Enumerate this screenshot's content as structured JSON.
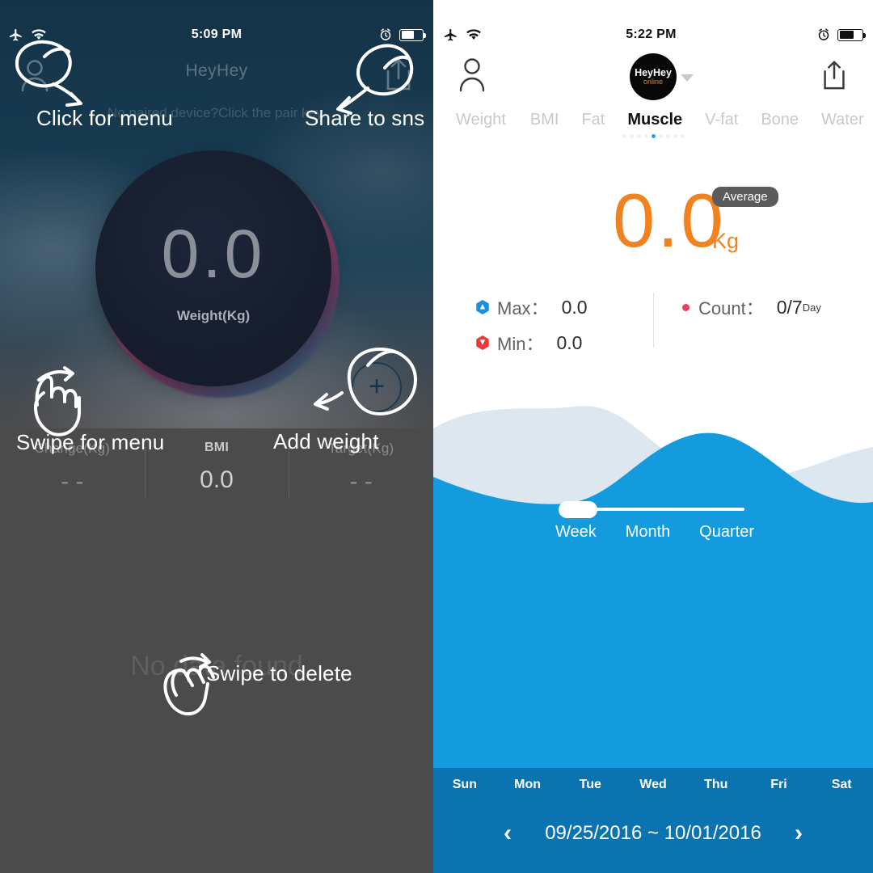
{
  "left_phone": {
    "status_bar": {
      "time": "5:09 PM",
      "airplane_icon": "airplane-icon",
      "wifi_icon": "wifi-icon",
      "alarm_icon": "alarm-clock-icon",
      "battery_icon": "battery-icon"
    },
    "nav": {
      "title": "HeyHey",
      "left_icon": "person-icon",
      "right_icon": "share-icon"
    },
    "pair_hint": "No paired device?Click the pair key.",
    "scale": {
      "value": "0.0",
      "unit_label": "Weight(Kg)"
    },
    "add_button": {
      "icon": "plus-icon"
    },
    "stats": [
      {
        "label": "Change(Kg)",
        "value": "- -"
      },
      {
        "label": "BMI",
        "value": "0.0"
      },
      {
        "label": "Target(Kg)",
        "value": "- -"
      }
    ],
    "empty_state": "No data found",
    "annotations": [
      {
        "text": "Click for menu"
      },
      {
        "text": "Share to sns"
      },
      {
        "text": "Swipe for menu"
      },
      {
        "text": "Add weight"
      },
      {
        "text": "Swipe to delete"
      }
    ]
  },
  "right_phone": {
    "status_bar": {
      "time": "5:22 PM",
      "airplane_icon": "airplane-icon",
      "wifi_icon": "wifi-icon",
      "alarm_icon": "alarm-clock-icon",
      "battery_icon": "battery-icon"
    },
    "nav": {
      "left_icon": "person-icon",
      "right_icon": "share-icon",
      "avatar_name": "HeyHey",
      "avatar_status": "online",
      "caret_icon": "chevron-down-icon"
    },
    "tabs": [
      {
        "label": "Weight",
        "active": false
      },
      {
        "label": "BMI",
        "active": false
      },
      {
        "label": "Fat",
        "active": false
      },
      {
        "label": "Muscle",
        "active": true
      },
      {
        "label": "V-fat",
        "active": false
      },
      {
        "label": "Bone",
        "active": false
      },
      {
        "label": "Water",
        "active": false
      }
    ],
    "page_dots": {
      "count": 9,
      "active_index": 4
    },
    "reading": {
      "value": "0.0",
      "unit": "Kg",
      "badge": "Average"
    },
    "metrics": [
      {
        "icon": "blue-hexagon-up-icon",
        "label": "Max：",
        "value": "0.0"
      },
      {
        "icon": "red-hexagon-down-icon",
        "label": "Min：",
        "value": "0.0"
      },
      {
        "icon": "pink-dot-icon",
        "label": "Count：",
        "value": "0/7",
        "sub": "Day"
      }
    ],
    "range_slider": {
      "options": [
        "Week",
        "Month",
        "Quarter"
      ],
      "selected": "Week"
    },
    "weekdays": [
      "Sun",
      "Mon",
      "Tue",
      "Wed",
      "Thu",
      "Fri",
      "Sat"
    ],
    "date_range": {
      "text": "09/25/2016 ~ 10/01/2016",
      "prev_icon": "chevron-left-icon",
      "next_icon": "chevron-right-icon"
    }
  },
  "colors": {
    "accent_orange": "#f08220",
    "wave_blue": "#139bde",
    "wave_light": "#dde7ef",
    "daybar_blue": "#0b73af",
    "navy": "#143347",
    "gray_bg": "#4b4b4b",
    "max_blue": "#1b8fe0",
    "min_red": "#e8393b",
    "count_pink": "#ec3f62"
  }
}
